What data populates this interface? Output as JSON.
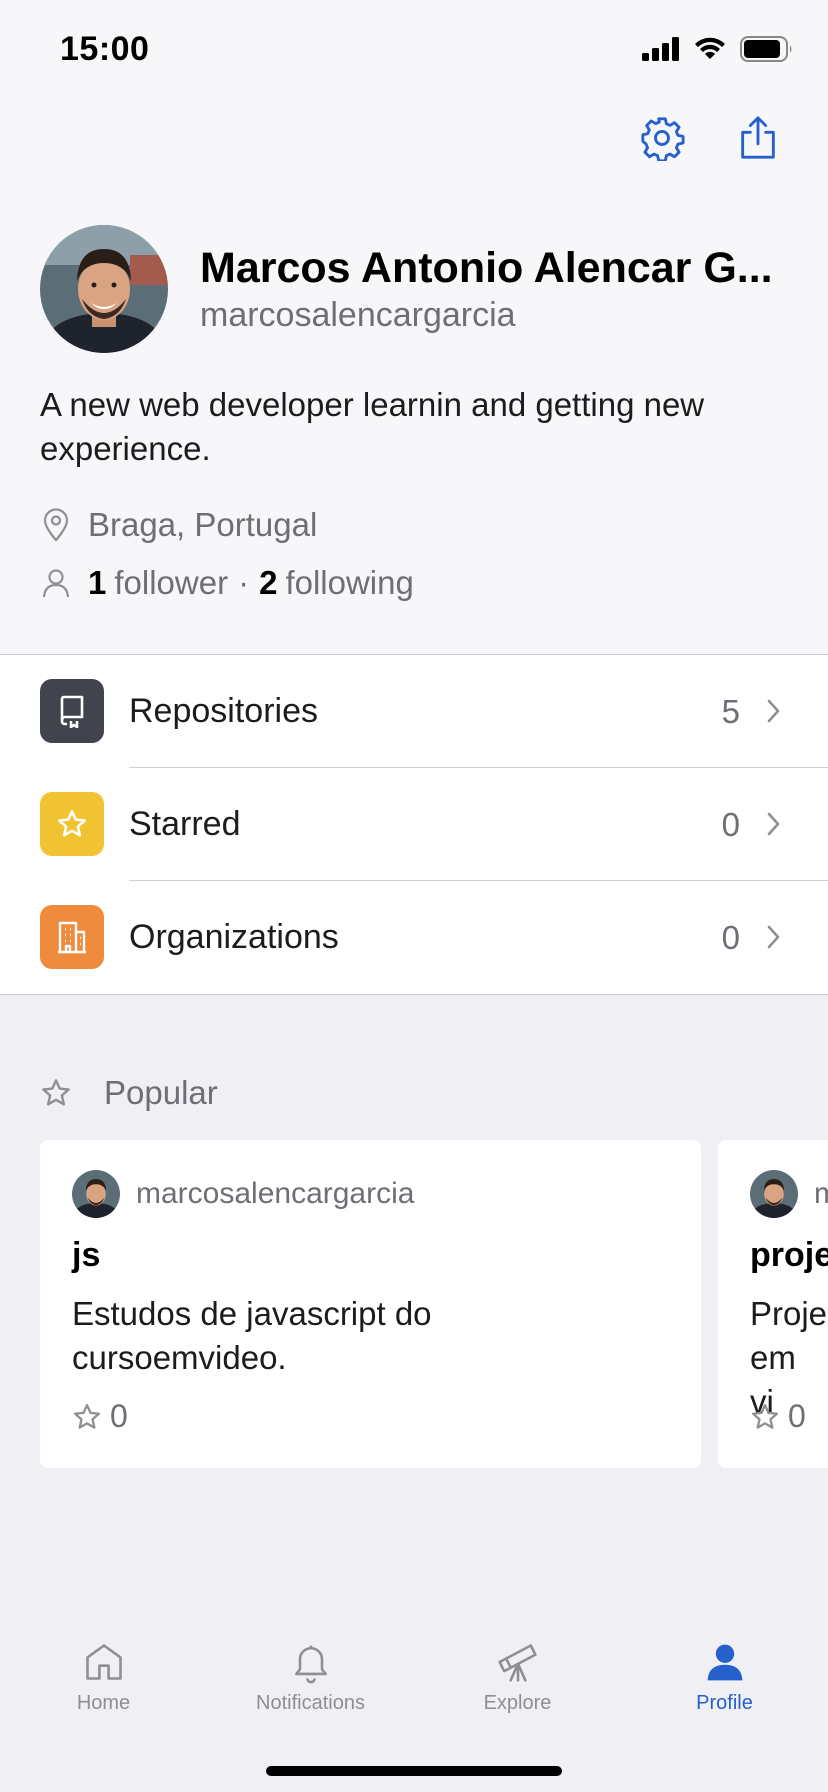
{
  "status_bar": {
    "time": "15:00"
  },
  "profile": {
    "name": "Marcos Antonio Alencar G...",
    "login": "marcosalencargarcia",
    "bio": "A new web developer learnin and getting new experience.",
    "location": "Braga, Portugal",
    "followers_count": "1",
    "followers_label": "follower",
    "separator": "·",
    "following_count": "2",
    "following_label": "following"
  },
  "menu": [
    {
      "label": "Repositories",
      "count": "5",
      "icon": "repo-icon",
      "color": "#41434d"
    },
    {
      "label": "Starred",
      "count": "0",
      "icon": "star-icon",
      "color": "#f1c232"
    },
    {
      "label": "Organizations",
      "count": "0",
      "icon": "building-icon",
      "color": "#ef8b3c"
    }
  ],
  "popular": {
    "heading": "Popular",
    "cards": [
      {
        "owner": "marcosalencargarcia",
        "repo": "js",
        "description": "Estudos de javascript do cursoemvideo.",
        "stars": "0"
      },
      {
        "owner": "m",
        "repo": "proje",
        "description": "Proje em vi",
        "stars": "0"
      }
    ]
  },
  "tabs": [
    {
      "label": "Home",
      "icon": "home-icon"
    },
    {
      "label": "Notifications",
      "icon": "bell-icon"
    },
    {
      "label": "Explore",
      "icon": "telescope-icon"
    },
    {
      "label": "Profile",
      "icon": "person-icon",
      "active": true
    }
  ],
  "colors": {
    "accent": "#2560cc",
    "secondary_text": "#6e6e76",
    "background": "#efeff4"
  }
}
